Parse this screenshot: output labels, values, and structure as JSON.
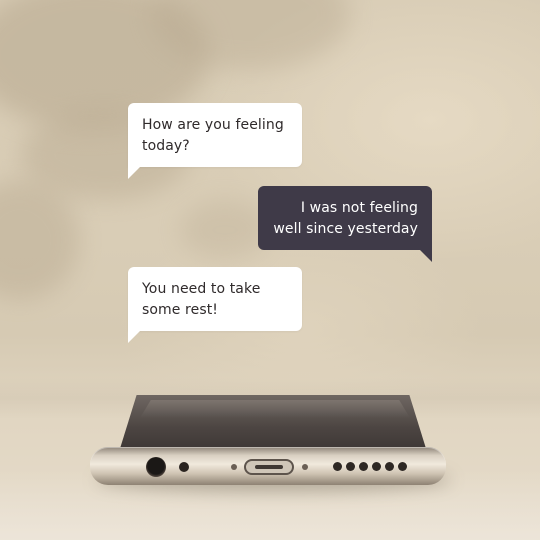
{
  "colors": {
    "incoming_bubble": "#ffffff",
    "outgoing_bubble": "#3f3a48",
    "incoming_text": "#2f2a2b",
    "outgoing_text": "#ffffff",
    "background": "#d8ccb5"
  },
  "messages": [
    {
      "sender": "other",
      "text": "How are you feeling today?"
    },
    {
      "sender": "me",
      "text": "I was not feeling well since yesterday"
    },
    {
      "sender": "other",
      "text": "You need to take some rest!"
    }
  ],
  "photo": {
    "subject": "smartphone-lying-face-down-icon"
  }
}
